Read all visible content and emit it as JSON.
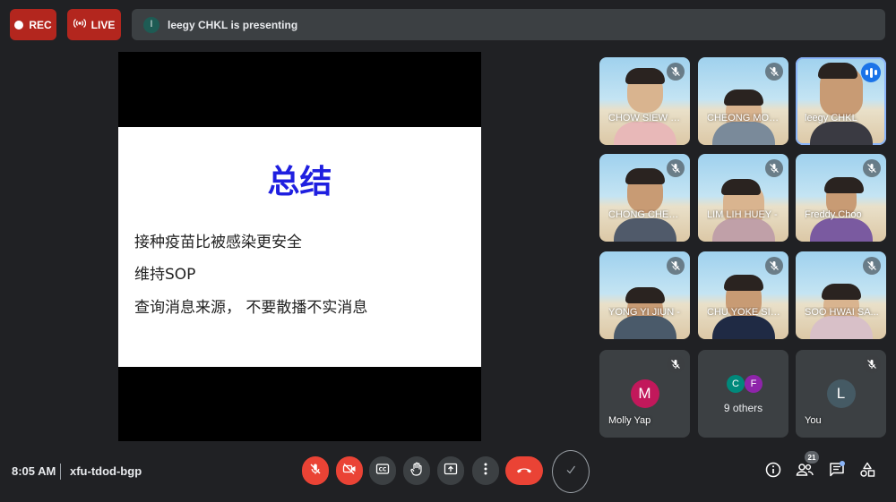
{
  "top": {
    "rec_label": "REC",
    "live_label": "LIVE",
    "presenter_initial": "l",
    "presenter_text": "leegy CHKL is presenting"
  },
  "slide": {
    "title": "总结",
    "lines": [
      "接种疫苗比被感染更安全",
      "维持SOP",
      "查询消息来源， 不要散播不实消息"
    ]
  },
  "participants": [
    {
      "name": "CHOW SIEW C...",
      "muted": true
    },
    {
      "name": "CHEONG MOE...",
      "muted": true
    },
    {
      "name": "leegy CHKL",
      "muted": false,
      "speaking": true
    },
    {
      "name": "CHONG CHEE ...",
      "muted": true
    },
    {
      "name": "LIM LIH HUEY -",
      "muted": true
    },
    {
      "name": "Freddy Choo",
      "muted": true
    },
    {
      "name": "YONG YI JIUN -",
      "muted": true
    },
    {
      "name": "CHU YOKE SIN...",
      "muted": true
    },
    {
      "name": "SOO HWAI SA...",
      "muted": true
    }
  ],
  "no_video_tiles": {
    "molly": {
      "initial": "M",
      "name": "Molly Yap",
      "color": "#c2185b"
    },
    "others": {
      "initials": [
        "C",
        "F"
      ],
      "colors": [
        "#00897b",
        "#8e24aa"
      ],
      "label": "9 others"
    },
    "you": {
      "initial": "L",
      "name": "You",
      "color": "#455a64"
    }
  },
  "bottom": {
    "time": "8:05 AM",
    "meeting_code": "xfu-tdod-bgp",
    "people_count": "21"
  }
}
